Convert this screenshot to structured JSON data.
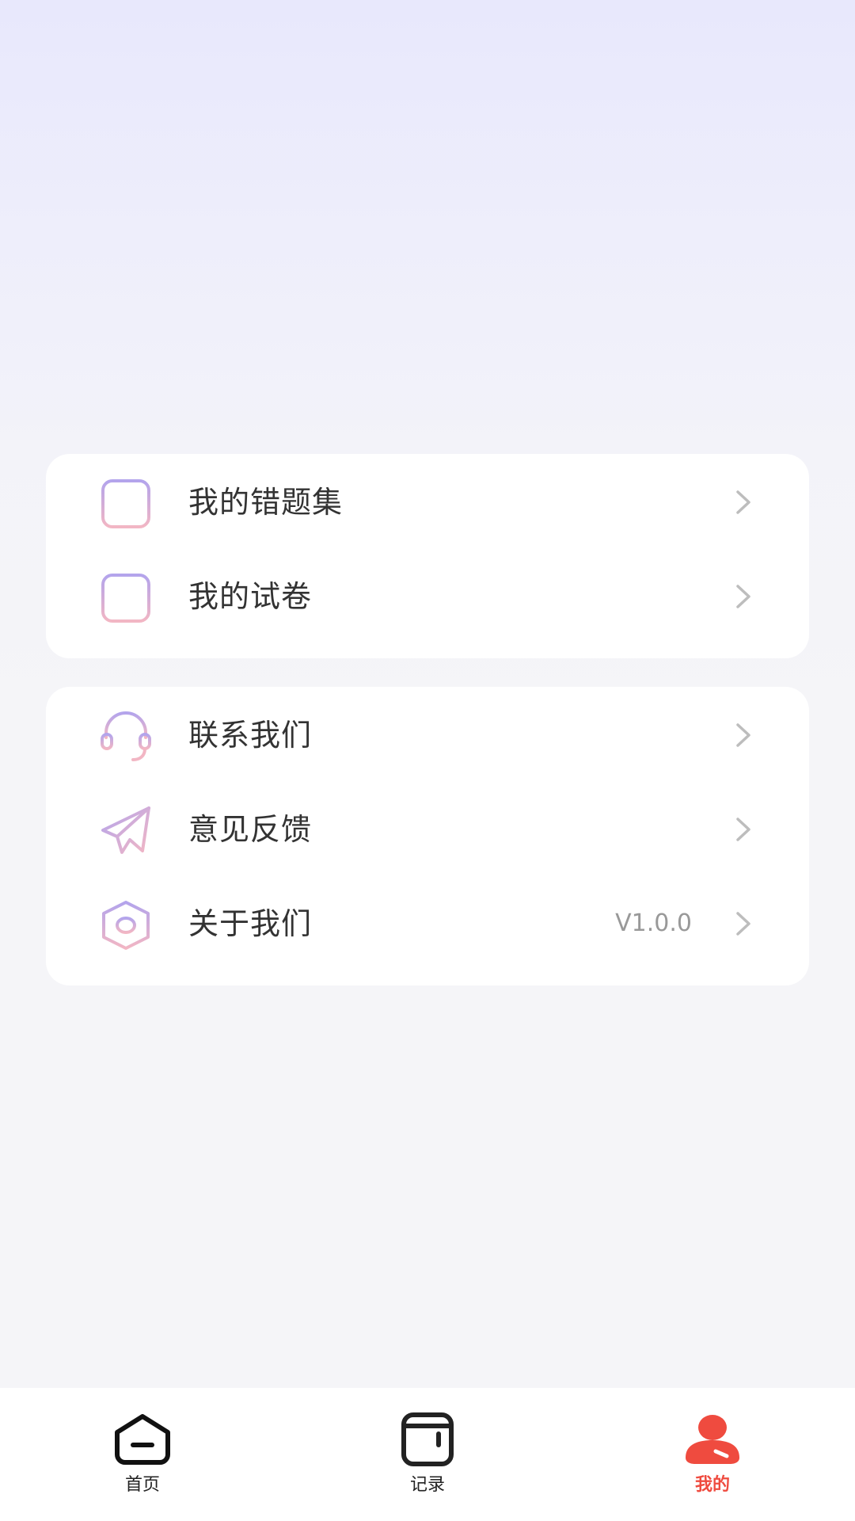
{
  "colors": {
    "accent": "#ef4b3f",
    "icon_gradient_start": "#b3a4ec",
    "icon_gradient_end": "#f2b6c4",
    "chevron": "#bdbdbd",
    "text": "#333333",
    "muted_text": "#999999"
  },
  "menu_group_1": {
    "items": [
      {
        "label": "我的错题集",
        "icon": "wrong-questions-icon"
      },
      {
        "label": "我的试卷",
        "icon": "exam-paper-icon"
      }
    ]
  },
  "menu_group_2": {
    "items": [
      {
        "label": "联系我们",
        "icon": "headset-icon"
      },
      {
        "label": "意见反馈",
        "icon": "paper-plane-icon"
      },
      {
        "label": "关于我们",
        "icon": "hexagon-info-icon",
        "value": "V1.0.0"
      }
    ]
  },
  "tabbar": {
    "tabs": [
      {
        "label": "首页",
        "icon": "home-icon",
        "active": false
      },
      {
        "label": "记录",
        "icon": "record-icon",
        "active": false
      },
      {
        "label": "我的",
        "icon": "user-icon",
        "active": true
      }
    ]
  }
}
